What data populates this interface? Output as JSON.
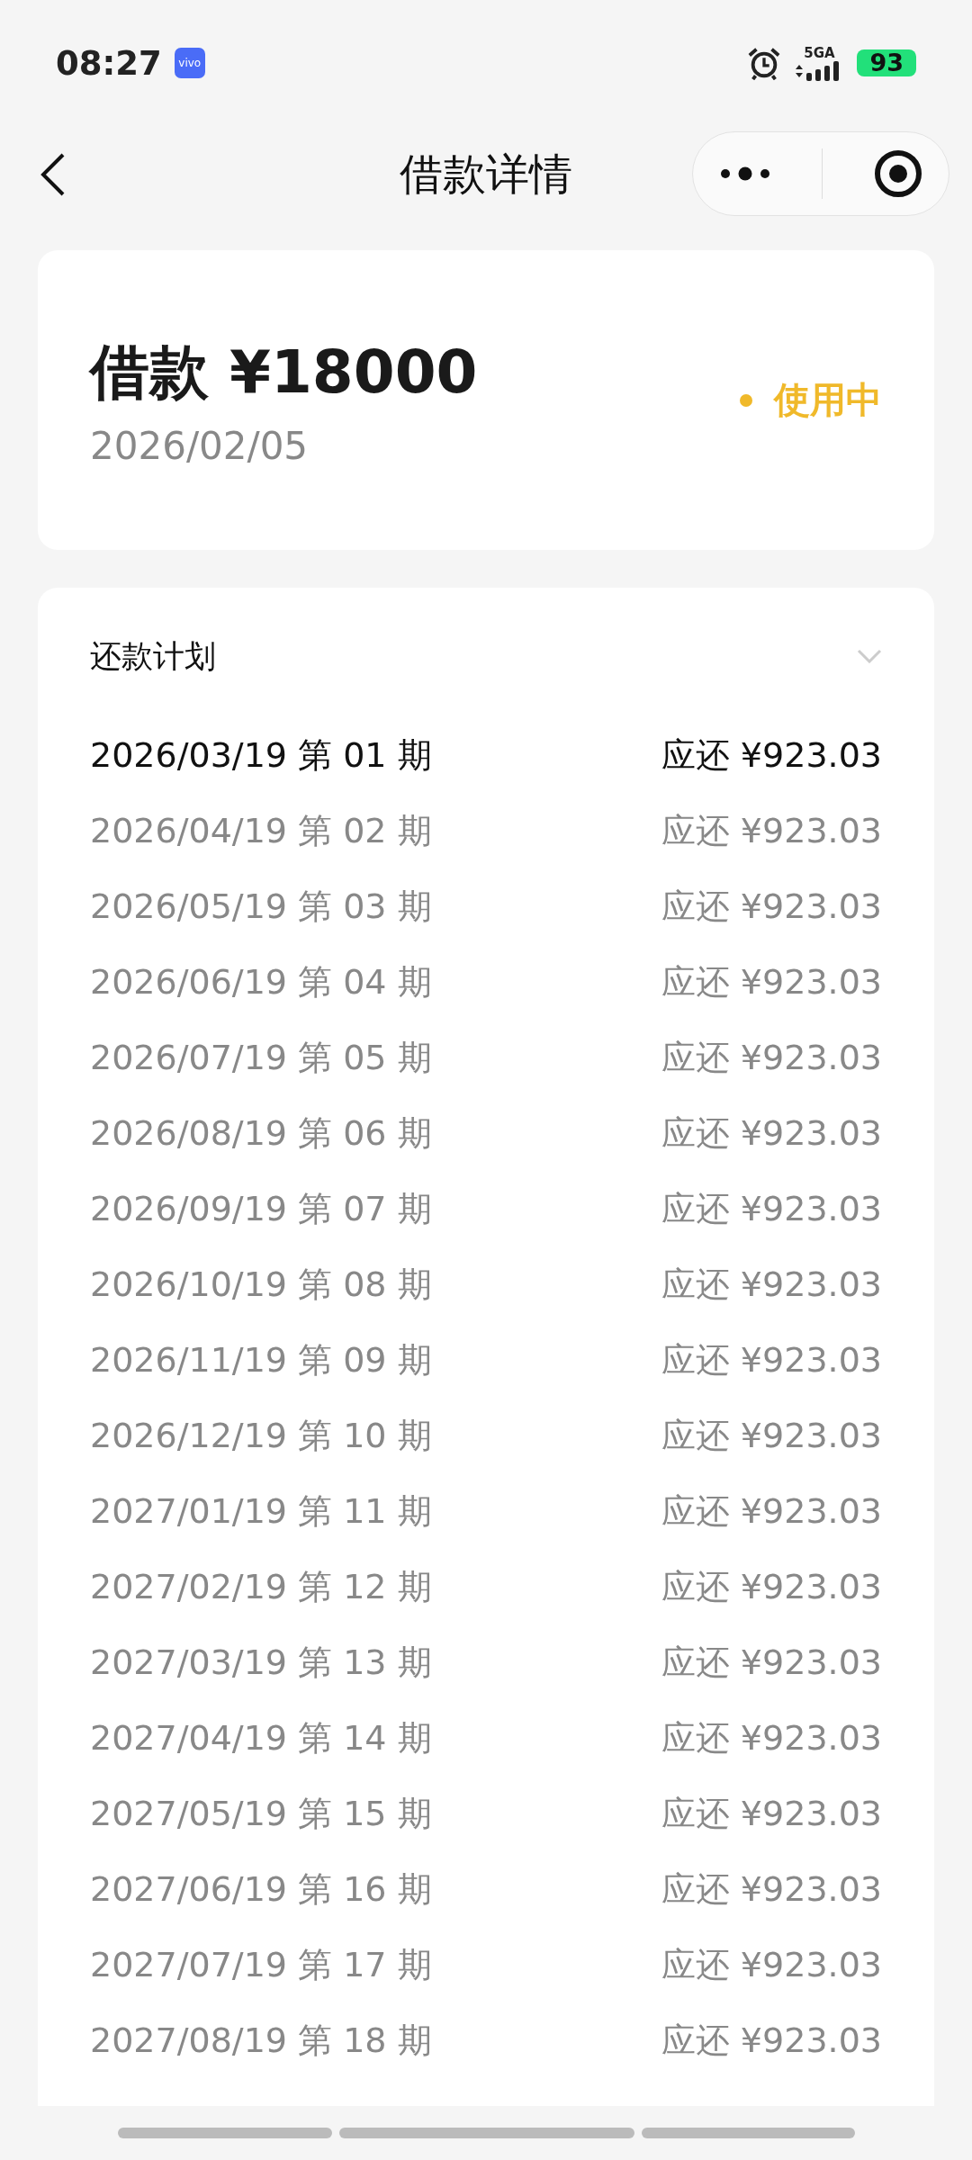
{
  "status_bar": {
    "time": "08:27",
    "app_badge": "vivo",
    "network": "5GA",
    "battery": "93"
  },
  "header": {
    "title": "借款详情"
  },
  "loan": {
    "title": "借款 ¥18000",
    "date": "2026/02/05",
    "status": {
      "label": "使用中",
      "color": "#f0b92a"
    }
  },
  "plan": {
    "title": "还款计划",
    "expanded": true,
    "rows": [
      {
        "period": "2026/03/19 第 01 期",
        "amount": "应还 ¥923.03",
        "current": true
      },
      {
        "period": "2026/04/19 第 02 期",
        "amount": "应还 ¥923.03",
        "current": false
      },
      {
        "period": "2026/05/19 第 03 期",
        "amount": "应还 ¥923.03",
        "current": false
      },
      {
        "period": "2026/06/19 第 04 期",
        "amount": "应还 ¥923.03",
        "current": false
      },
      {
        "period": "2026/07/19 第 05 期",
        "amount": "应还 ¥923.03",
        "current": false
      },
      {
        "period": "2026/08/19 第 06 期",
        "amount": "应还 ¥923.03",
        "current": false
      },
      {
        "period": "2026/09/19 第 07 期",
        "amount": "应还 ¥923.03",
        "current": false
      },
      {
        "period": "2026/10/19 第 08 期",
        "amount": "应还 ¥923.03",
        "current": false
      },
      {
        "period": "2026/11/19 第 09 期",
        "amount": "应还 ¥923.03",
        "current": false
      },
      {
        "period": "2026/12/19 第 10 期",
        "amount": "应还 ¥923.03",
        "current": false
      },
      {
        "period": "2027/01/19 第 11 期",
        "amount": "应还 ¥923.03",
        "current": false
      },
      {
        "period": "2027/02/19 第 12 期",
        "amount": "应还 ¥923.03",
        "current": false
      },
      {
        "period": "2027/03/19 第 13 期",
        "amount": "应还 ¥923.03",
        "current": false
      },
      {
        "period": "2027/04/19 第 14 期",
        "amount": "应还 ¥923.03",
        "current": false
      },
      {
        "period": "2027/05/19 第 15 期",
        "amount": "应还 ¥923.03",
        "current": false
      },
      {
        "period": "2027/06/19 第 16 期",
        "amount": "应还 ¥923.03",
        "current": false
      },
      {
        "period": "2027/07/19 第 17 期",
        "amount": "应还 ¥923.03",
        "current": false
      },
      {
        "period": "2027/08/19 第 18 期",
        "amount": "应还 ¥923.03",
        "current": false
      }
    ]
  }
}
